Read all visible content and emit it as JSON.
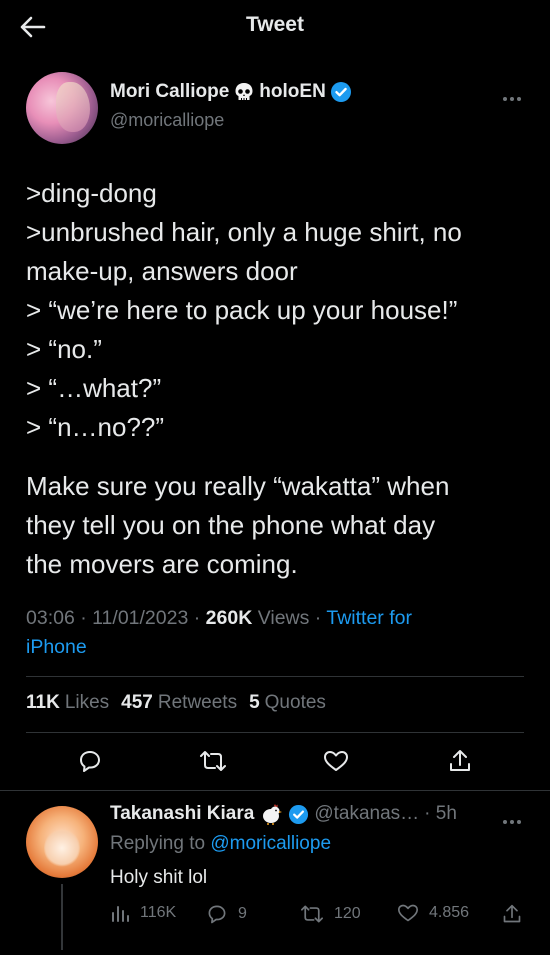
{
  "header": {
    "title": "Tweet"
  },
  "tweet": {
    "author_name": "Mori Calliope",
    "author_name_suffix": "holoEN",
    "author_handle": "@moricalliope",
    "lines": [
      ">ding-dong",
      ">unbrushed hair, only a huge shirt, no",
      "make-up, answers door",
      "> “we’re here to pack up your house!”",
      "> “no.”",
      "> “…what?”",
      "> “n…no??”"
    ],
    "para2": [
      "Make sure you really “wakatta” when",
      "they tell you on the phone what day",
      "the movers are coming."
    ],
    "time": "03:06",
    "date": "11/01/2023",
    "views_count": "260K",
    "views_label": "Views",
    "source_line1": "Twitter for",
    "source_line2": "iPhone",
    "likes_count": "11K",
    "likes_label": "Likes",
    "retweets_count": "457",
    "retweets_label": "Retweets",
    "quotes_count": "5",
    "quotes_label": "Quotes"
  },
  "reply": {
    "name": "Takanashi Kiara",
    "handle": "@takanas…",
    "age": "· 5h",
    "replying_prefix": "Replying to",
    "replying_to": "@moricalliope",
    "text": "Holy shit lol",
    "views": "116K",
    "replies": "9",
    "retweets": "120",
    "likes": "4.856"
  },
  "colors": {
    "background": "#000000",
    "accent": "#1d9bf0",
    "muted": "#71767b",
    "text": "#e7e9ea"
  },
  "icons": [
    "back-arrow-icon",
    "skull-icon",
    "verified-badge-icon",
    "more-icon",
    "reply-icon",
    "retweet-icon",
    "like-icon",
    "share-icon",
    "chicken-icon",
    "views-icon"
  ]
}
